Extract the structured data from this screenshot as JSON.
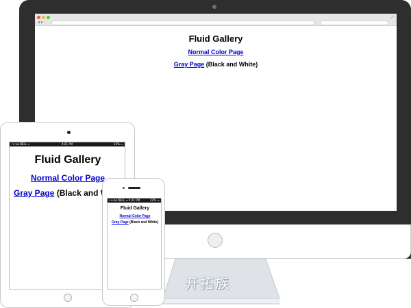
{
  "gallery": {
    "title": "Fluid Gallery",
    "normal_link": "Normal Color Page",
    "gray_link": "Gray Page",
    "gray_suffix": "(Black and White)"
  },
  "status_bar": {
    "carrier": "•••oo BELL ᯤ",
    "time": "4:21 PM",
    "battery": "22% ▭"
  },
  "browser": {
    "nav_icons": "◂ ▸",
    "expand_icon": "⤢"
  },
  "watermark": "开拓族",
  "colors": {
    "monitor_bezel": "#2e2e2e",
    "link": "#0000cc",
    "browser_bar": "#e6e6e6",
    "stand": "#dfe3e8"
  },
  "icons": [
    "monitor-camera-icon",
    "home-button-icon",
    "phone-speaker-icon",
    "browser-dots-icon",
    "expand-icon"
  ]
}
